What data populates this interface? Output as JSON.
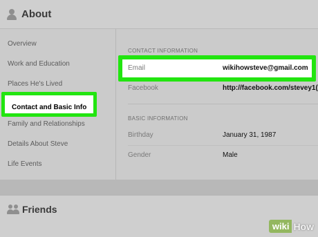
{
  "about": {
    "title": "About",
    "icon": "person-icon"
  },
  "sidebar": {
    "items": [
      {
        "label": "Overview"
      },
      {
        "label": "Work and Education"
      },
      {
        "label": "Places He's Lived"
      },
      {
        "label": "Contact and Basic Info",
        "active": true
      },
      {
        "label": "Family and Relationships"
      },
      {
        "label": "Details About Steve"
      },
      {
        "label": "Life Events"
      }
    ]
  },
  "contact": {
    "heading": "CONTACT INFORMATION",
    "email_label": "Email",
    "email_value": "wikihowsteve@gmail.com",
    "facebook_label": "Facebook",
    "facebook_value": "http://facebook.com/stevey1("
  },
  "basic": {
    "heading": "BASIC INFORMATION",
    "birthday_label": "Birthday",
    "birthday_value": "January 31, 1987",
    "gender_label": "Gender",
    "gender_value": "Male"
  },
  "friends": {
    "title": "Friends",
    "icon": "friends-icon"
  },
  "watermark": {
    "wiki": "wiki",
    "how": "How"
  },
  "colors": {
    "highlight": "#22e510",
    "watermark_green": "#93b75f"
  }
}
